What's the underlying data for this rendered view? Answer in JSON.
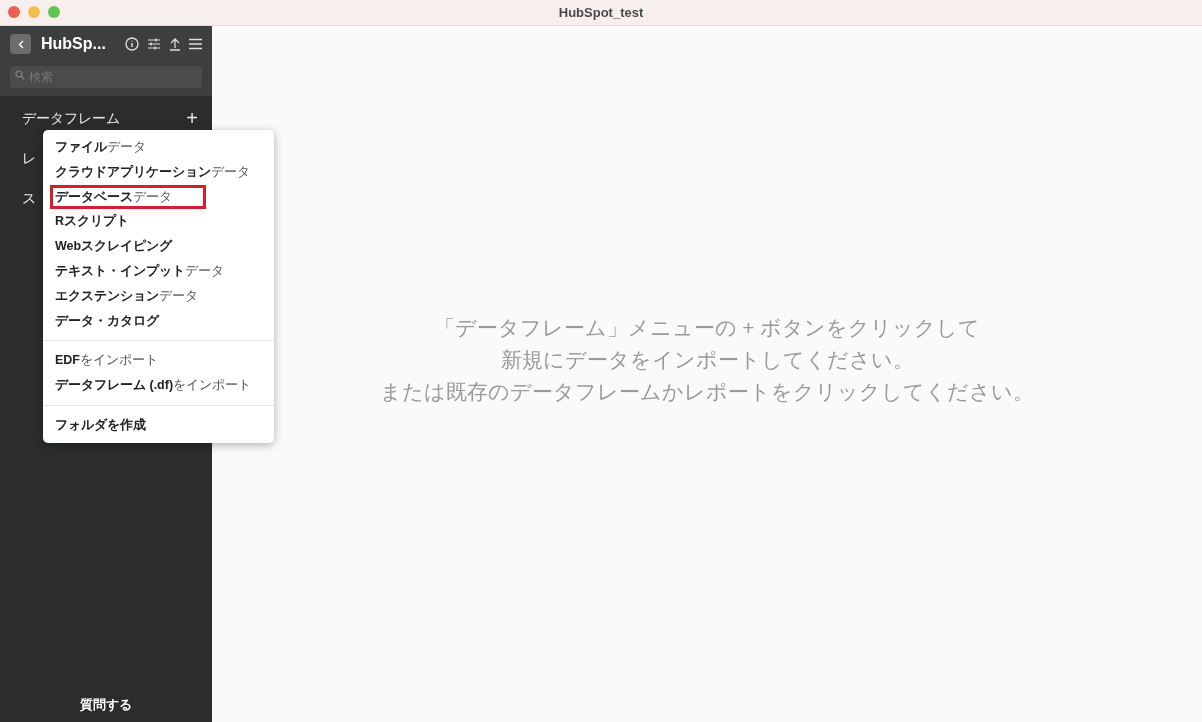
{
  "window": {
    "title": "HubSpot_test"
  },
  "sidebar": {
    "project_title": "HubSp...",
    "search": {
      "placeholder": "検索"
    },
    "sections": [
      {
        "label": "データフレーム",
        "add_button": "+"
      },
      {
        "label": "レ"
      },
      {
        "label": "ス"
      }
    ],
    "footer": "質問する"
  },
  "menu": {
    "groups": [
      [
        {
          "label": "**ファイル**データ",
          "highlighted": false
        },
        {
          "label": "**クラウドアプリケーション**データ",
          "highlighted": false
        },
        {
          "label": "**データベース**データ",
          "highlighted": true
        },
        {
          "label": "**Rスクリプト**",
          "highlighted": false
        },
        {
          "label": "**Webスクレイピング**",
          "highlighted": false
        },
        {
          "label": "**テキスト・インプット**データ",
          "highlighted": false
        },
        {
          "label": "**エクステンション**データ",
          "highlighted": false
        },
        {
          "label": "**データ・カタログ**",
          "highlighted": false
        }
      ],
      [
        {
          "label": "**EDF**をインポート",
          "highlighted": false
        },
        {
          "label": "**データフレーム (.df)**をインポート",
          "highlighted": false
        }
      ],
      [
        {
          "label": "**フォルダを作成**",
          "highlighted": false
        }
      ]
    ]
  },
  "main": {
    "message": [
      "「データフレーム」メニューの + ボタンをクリックして",
      "新規にデータをインポートしてください。",
      "または既存のデータフレームかレポートをクリックしてください。"
    ]
  }
}
